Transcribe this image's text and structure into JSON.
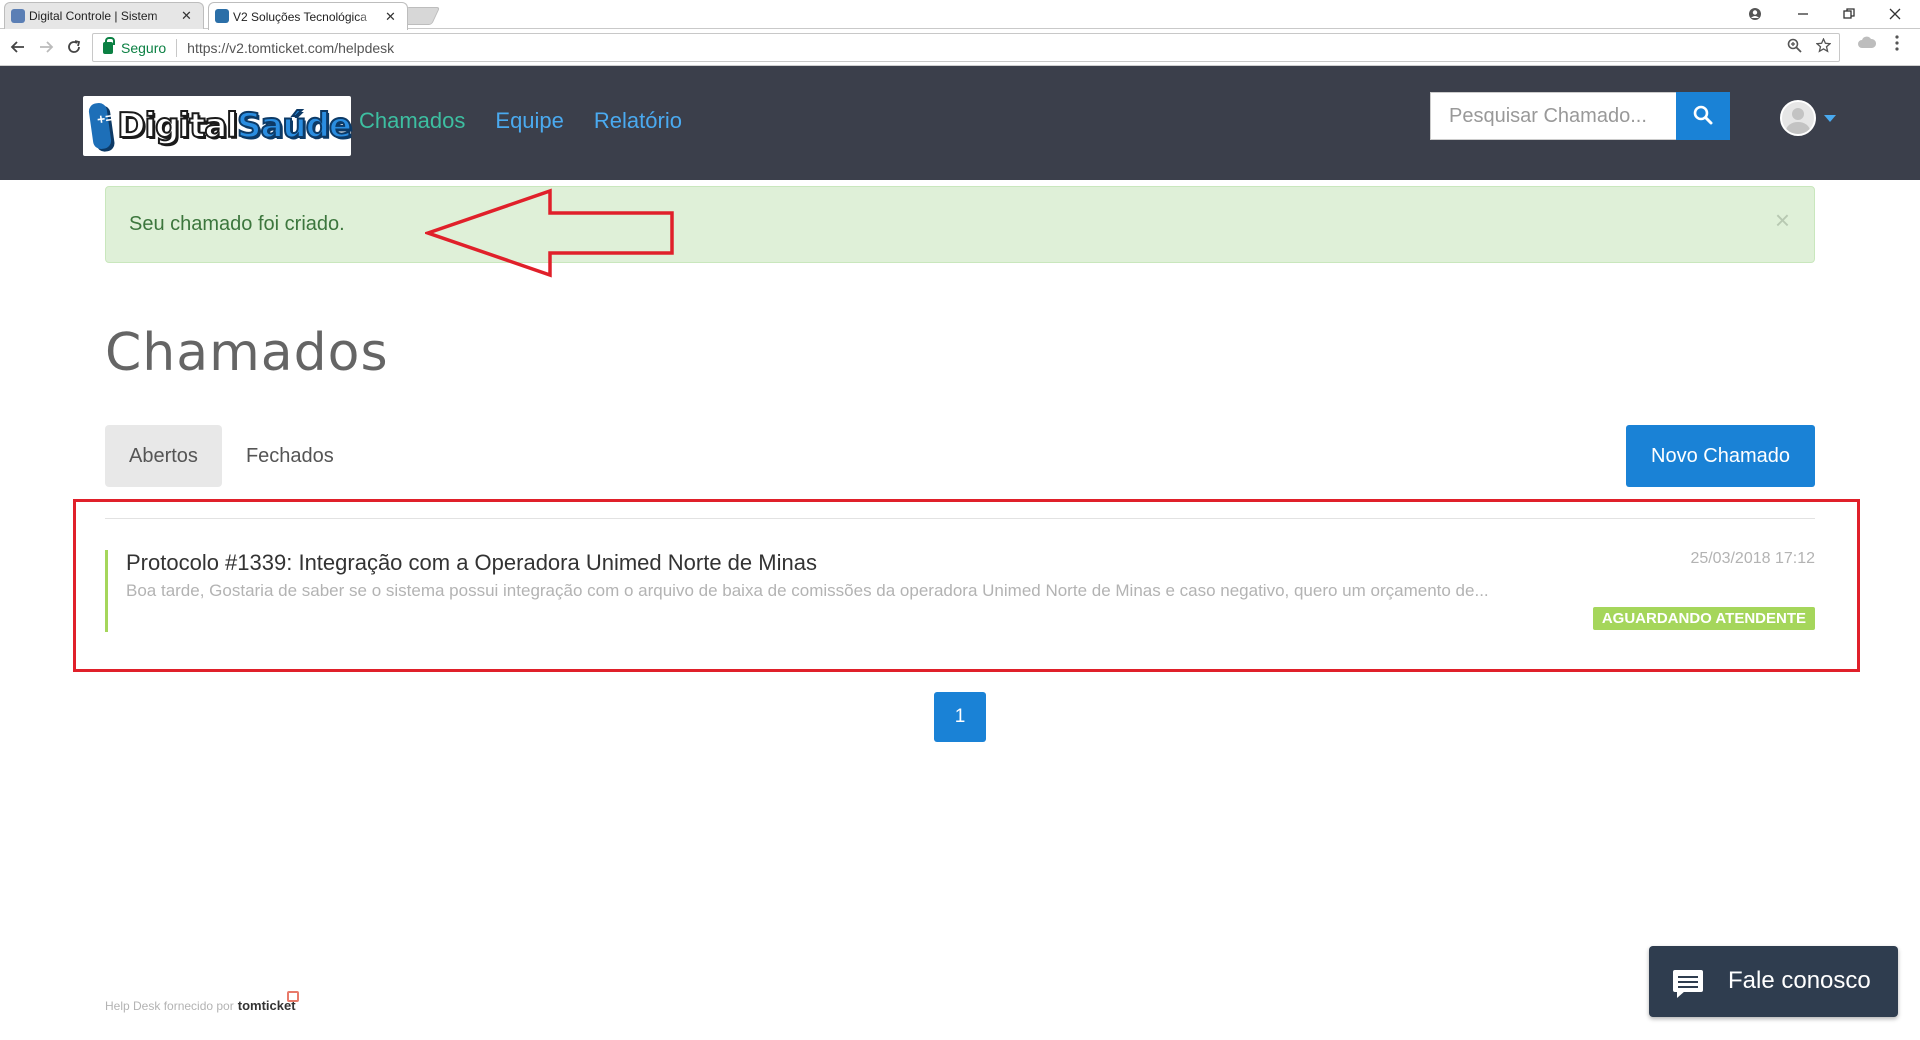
{
  "browser": {
    "tabs": [
      {
        "title": "Digital Controle | Sistem",
        "active": false
      },
      {
        "title": "V2 Soluções Tecnológica",
        "active": true
      }
    ],
    "address": {
      "secure_label": "Seguro",
      "url": "https://v2.tomticket.com/helpdesk"
    }
  },
  "header": {
    "logo": {
      "part1": "Digital",
      "part2": "Saúde"
    },
    "nav": [
      {
        "label": "Chamados",
        "active": true
      },
      {
        "label": "Equipe",
        "active": false
      },
      {
        "label": "Relatório",
        "active": false
      }
    ],
    "search_placeholder": "Pesquisar Chamado..."
  },
  "alert": {
    "text": "Seu chamado foi criado.",
    "close": "×"
  },
  "page": {
    "title": "Chamados",
    "tabs": [
      {
        "label": "Abertos",
        "active": true
      },
      {
        "label": "Fechados",
        "active": false
      }
    ],
    "new_button": "Novo Chamado"
  },
  "tickets": [
    {
      "title": "Protocolo #1339: Integração com a Operadora Unimed Norte de Minas",
      "date": "25/03/2018 17:12",
      "description": "Boa tarde, Gostaria de saber se o sistema possui integração com o arquivo de baixa de comissões da operadora Unimed Norte de Minas e caso negativo, quero um orçamento de...",
      "status": "AGUARDANDO ATENDENTE"
    }
  ],
  "pagination": {
    "current": "1"
  },
  "footer": {
    "text": "Help Desk fornecido por",
    "brand": "tomticket"
  },
  "chat": {
    "label": "Fale conosco"
  },
  "colors": {
    "header_bg": "#3b3f4b",
    "nav_active": "#3dbfa1",
    "nav_link": "#4aaaf0",
    "primary": "#1a82d6",
    "alert_bg": "#dff0d8",
    "status_green": "#a5d65b",
    "annotation_red": "#e0202a"
  }
}
